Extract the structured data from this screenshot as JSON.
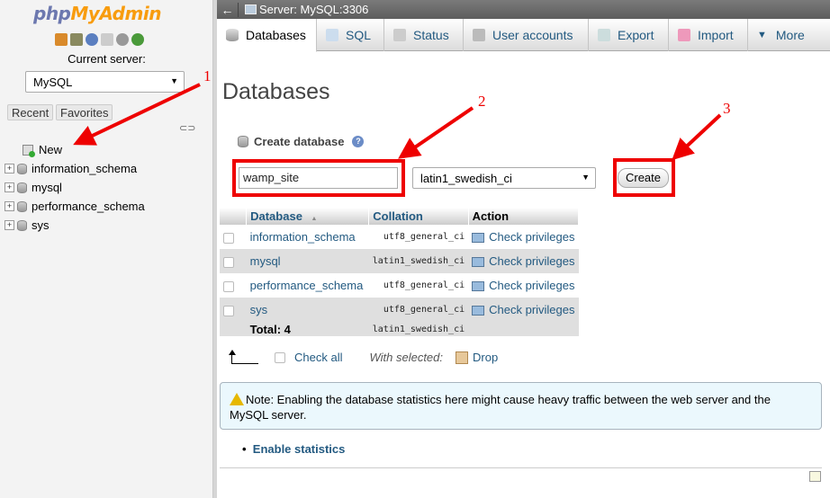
{
  "sidebar": {
    "logo_php": "php",
    "logo_myadmin": "MyAdmin",
    "current_server_label": "Current server:",
    "server_selected": "MySQL",
    "tabs": [
      "Recent",
      "Favorites"
    ],
    "tree": [
      {
        "label": "New",
        "type": "new"
      },
      {
        "label": "information_schema",
        "type": "db"
      },
      {
        "label": "mysql",
        "type": "db"
      },
      {
        "label": "performance_schema",
        "type": "db"
      },
      {
        "label": "sys",
        "type": "db"
      }
    ]
  },
  "topbar": {
    "back": "←",
    "server_title": "Server: MySQL:3306"
  },
  "menu": [
    {
      "label": "Databases",
      "active": true
    },
    {
      "label": "SQL"
    },
    {
      "label": "Status"
    },
    {
      "label": "User accounts"
    },
    {
      "label": "Export"
    },
    {
      "label": "Import"
    },
    {
      "label": "More",
      "dropdown": true
    }
  ],
  "page_title": "Databases",
  "create": {
    "label": "Create database",
    "name_value": "wamp_site",
    "collation": "latin1_swedish_ci",
    "button": "Create"
  },
  "annotations": [
    "1",
    "2",
    "3"
  ],
  "table": {
    "headers": [
      "Database",
      "Collation",
      "Action"
    ],
    "sort_arrow": "▲",
    "rows": [
      {
        "name": "information_schema",
        "collation": "utf8_general_ci",
        "action": "Check privileges"
      },
      {
        "name": "mysql",
        "collation": "latin1_swedish_ci",
        "action": "Check privileges"
      },
      {
        "name": "performance_schema",
        "collation": "utf8_general_ci",
        "action": "Check privileges"
      },
      {
        "name": "sys",
        "collation": "utf8_general_ci",
        "action": "Check privileges"
      }
    ],
    "total_label": "Total: 4",
    "total_collation": "latin1_swedish_ci"
  },
  "bulk": {
    "check_all": "Check all",
    "with_selected": "With selected:",
    "drop": "Drop"
  },
  "notice": "Note: Enabling the database statistics here might cause heavy traffic between the web server and the MySQL server.",
  "enable_stats": "Enable statistics",
  "colors": {
    "accent": "#235a81",
    "annotation": "#e00000"
  }
}
